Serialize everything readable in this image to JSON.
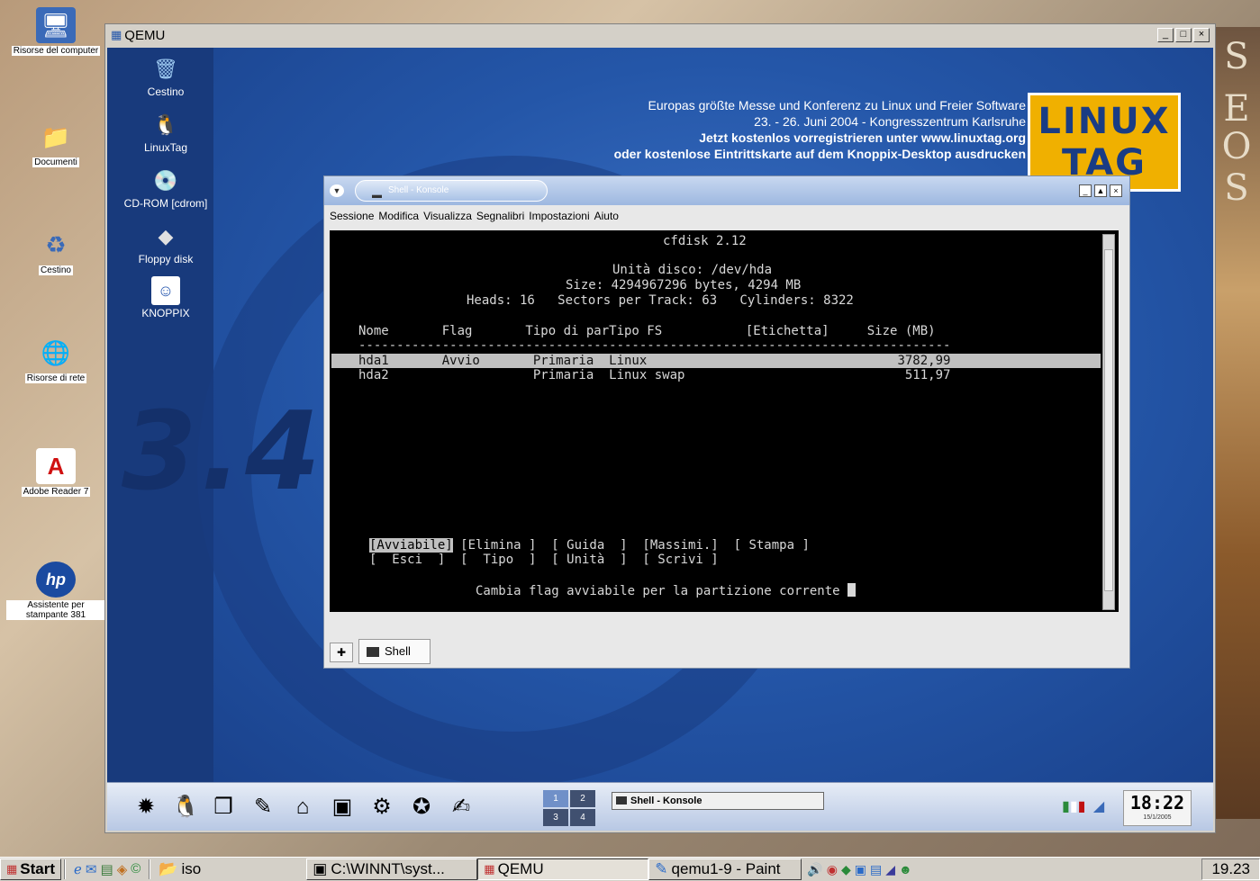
{
  "host_desktop": {
    "icons": [
      {
        "label": "Risorse del computer",
        "icon": "computer-icon"
      },
      {
        "label": "Documenti",
        "icon": "folder-icon"
      },
      {
        "label": "Cestino",
        "icon": "recycle-bin-icon"
      },
      {
        "label": "Risorse di rete",
        "icon": "network-icon"
      },
      {
        "label": "Adobe Reader 7",
        "icon": "adobe-reader-icon"
      },
      {
        "label": "Assistente per stampante 381",
        "icon": "hp-printer-icon"
      }
    ],
    "right_letters": [
      "S",
      "E",
      "O",
      "S"
    ]
  },
  "qemu_window": {
    "title": "QEMU",
    "controls": {
      "minimize": "_",
      "maximize": "□",
      "close": "×"
    }
  },
  "guest_desktop": {
    "icons": [
      {
        "label": "Cestino",
        "icon": "trash-icon"
      },
      {
        "label": "LinuxTag",
        "icon": "penguin-icon"
      },
      {
        "label": "CD-ROM [cdrom]",
        "icon": "cdrom-icon"
      },
      {
        "label": "Floppy disk",
        "icon": "floppy-icon"
      },
      {
        "label": "KNOPPIX",
        "icon": "knoppix-icon"
      }
    ],
    "wallpaper_text": "3.4",
    "banner": {
      "line1": "Europas größte Messe und Konferenz zu Linux und Freier Software",
      "line2": "23. - 26. Juni 2004  -  Kongresszentrum Karlsruhe",
      "line3": "Jetzt kostenlos vorregistrieren unter www.linuxtag.org",
      "line4": "oder kostenlose Eintrittskarte auf dem Knoppix-Desktop ausdrucken"
    },
    "logo": {
      "line1": "LINUX",
      "line2": "TAG"
    }
  },
  "konsole": {
    "title": "Shell - Konsole",
    "menu": [
      "Sessione",
      "Modifica",
      "Visualizza",
      "Segnalibri",
      "Impostazioni",
      "Aiuto"
    ],
    "tab_label": "Shell",
    "terminal": {
      "header": "cfdisk 2.12",
      "disk_line": "Unità disco: /dev/hda",
      "size_line": "Size: 4294967296 bytes, 4294 MB",
      "geometry_line": "Heads: 16   Sectors per Track: 63   Cylinders: 8322",
      "columns_line": "Nome       Flag       Tipo di parTipo FS           [Etichetta]     Size (MB)",
      "separator": "------------------------------------------------------------------------------",
      "row1": "hda1       Avvio       Primaria  Linux                                 3782,99",
      "row2": "hda2                   Primaria  Linux swap                             511,97",
      "menu_selected": "[Avviabile]",
      "menu_rest_1": " [Elimina ]  [ Guida  ]  [Massimi.]  [ Stampa ]",
      "menu_line_2": "[  Esci  ]  [  Tipo  ]  [ Unità  ]  [ Scrivi ]",
      "status_line": "Cambia flag avviabile per la partizione corrente "
    }
  },
  "kde_panel": {
    "pager": [
      "1",
      "2",
      "3",
      "4"
    ],
    "task": "Shell - Konsole",
    "clock_time": "18:22",
    "clock_date": "15/1/2005"
  },
  "host_taskbar": {
    "start": "Start",
    "tasks": [
      "iso",
      "C:\\WINNT\\syst...",
      "QEMU",
      "qemu1-9 - Paint"
    ],
    "clock": "19.23"
  }
}
